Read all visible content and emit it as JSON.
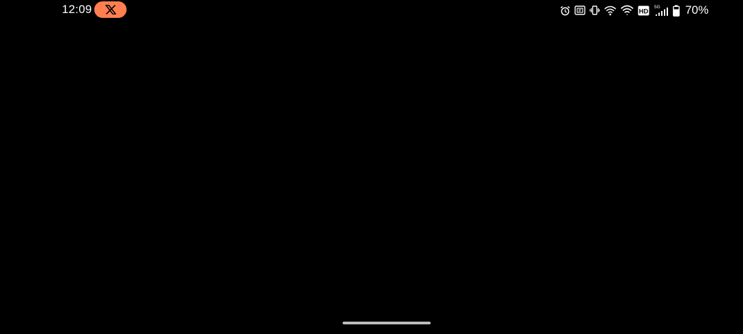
{
  "status_bar": {
    "time": "12:09",
    "notification_app_icon": "x-logo-icon",
    "notification_pill_color": "#FF7F50",
    "icons": [
      "alarm-icon",
      "nfc-icon",
      "vibrate-icon",
      "hotspot-icon",
      "wifi-icon",
      "hd-volte-icon",
      "signal-5g-icon",
      "battery-icon"
    ],
    "hd_label": "HD",
    "network_label": "5G",
    "battery_percent": "70%"
  },
  "screen": {
    "background": "#000000"
  },
  "navigation": {
    "handle": "gesture-nav-handle",
    "handle_color": "#BDBDBD"
  }
}
